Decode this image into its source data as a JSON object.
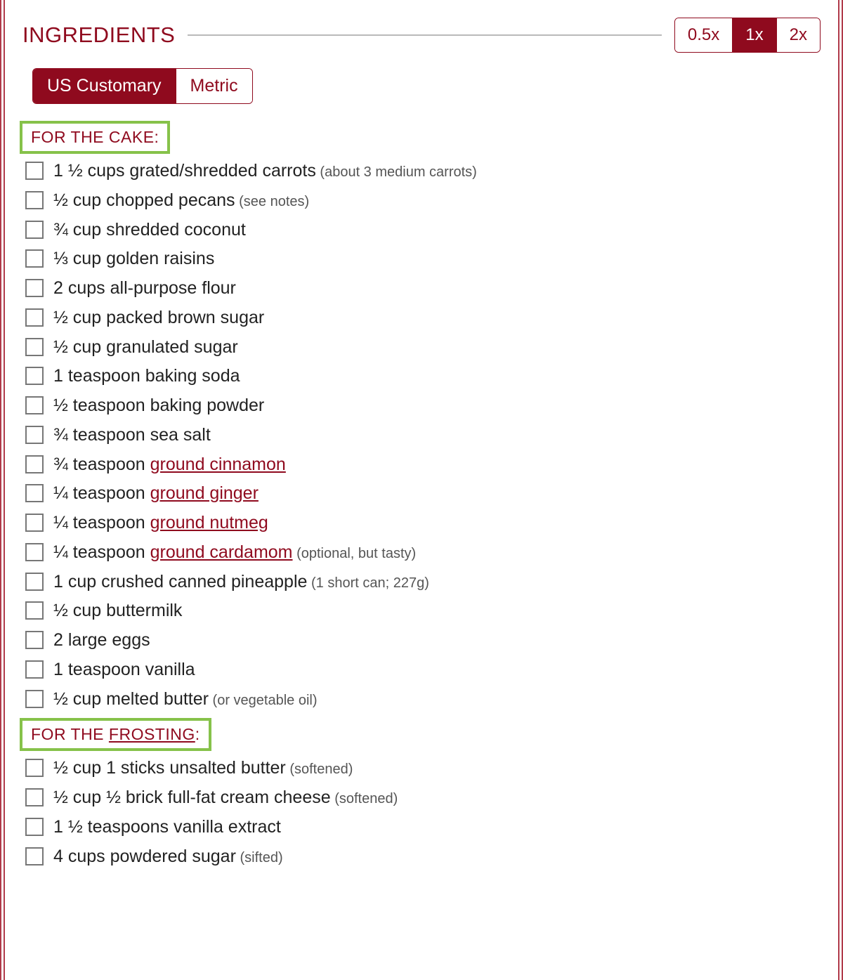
{
  "header": {
    "title": "INGREDIENTS"
  },
  "scale": {
    "options": [
      "0.5x",
      "1x",
      "2x"
    ],
    "active_index": 1
  },
  "units": {
    "options": [
      "US Customary",
      "Metric"
    ],
    "active_index": 0
  },
  "sections": [
    {
      "title_prefix": "FOR THE CAKE:",
      "title_link": "",
      "title_suffix": "",
      "highlight": true,
      "items": [
        {
          "amount": "1 ½",
          "unit": "cups",
          "name": "grated/shredded carrots",
          "note": "(about 3 medium carrots)",
          "link": false
        },
        {
          "amount": "½",
          "unit": "cup",
          "name": "chopped pecans",
          "note": "(see notes)",
          "link": false
        },
        {
          "amount": "¾",
          "unit": "cup",
          "name": "shredded coconut",
          "note": "",
          "link": false
        },
        {
          "amount": "⅓",
          "unit": "cup",
          "name": "golden raisins",
          "note": "",
          "link": false
        },
        {
          "amount": "2",
          "unit": "cups",
          "name": "all-purpose flour",
          "note": "",
          "link": false
        },
        {
          "amount": "½",
          "unit": "cup",
          "name": "packed brown sugar",
          "note": "",
          "link": false
        },
        {
          "amount": "½",
          "unit": "cup",
          "name": "granulated sugar",
          "note": "",
          "link": false
        },
        {
          "amount": "1",
          "unit": "teaspoon",
          "name": "baking soda",
          "note": "",
          "link": false
        },
        {
          "amount": "½",
          "unit": "teaspoon",
          "name": "baking powder",
          "note": "",
          "link": false
        },
        {
          "amount": "¾",
          "unit": "teaspoon",
          "name": "sea salt",
          "note": "",
          "link": false
        },
        {
          "amount": "¾",
          "unit": "teaspoon",
          "name": "ground cinnamon",
          "note": "",
          "link": true
        },
        {
          "amount": "¼",
          "unit": "teaspoon",
          "name": "ground ginger",
          "note": "",
          "link": true
        },
        {
          "amount": "¼",
          "unit": "teaspoon",
          "name": "ground nutmeg",
          "note": "",
          "link": true
        },
        {
          "amount": "¼",
          "unit": "teaspoon",
          "name": "ground cardamom",
          "note": "(optional, but tasty)",
          "link": true
        },
        {
          "amount": "1",
          "unit": "cup",
          "name": "crushed canned pineapple",
          "note": "(1 short can; 227g)",
          "link": false
        },
        {
          "amount": "½",
          "unit": "cup",
          "name": "buttermilk",
          "note": "",
          "link": false
        },
        {
          "amount": "2",
          "unit": "large",
          "name": "eggs",
          "note": "",
          "link": false
        },
        {
          "amount": "1",
          "unit": "teaspoon",
          "name": "vanilla",
          "note": "",
          "link": false
        },
        {
          "amount": "½",
          "unit": "cup",
          "name": "melted butter",
          "note": "(or vegetable oil)",
          "link": false
        }
      ]
    },
    {
      "title_prefix": "FOR THE ",
      "title_link": "FROSTING",
      "title_suffix": ":",
      "highlight": true,
      "items": [
        {
          "amount": "½",
          "unit": "cup",
          "name": "1 sticks unsalted butter",
          "note": "(softened)",
          "link": false
        },
        {
          "amount": "½",
          "unit": "cup",
          "name": "½ brick full-fat cream cheese",
          "note": "(softened)",
          "link": false
        },
        {
          "amount": "1 ½",
          "unit": "teaspoons",
          "name": "vanilla extract",
          "note": "",
          "link": false
        },
        {
          "amount": "4",
          "unit": "cups",
          "name": "powdered sugar",
          "note": "(sifted)",
          "link": false
        }
      ]
    }
  ]
}
